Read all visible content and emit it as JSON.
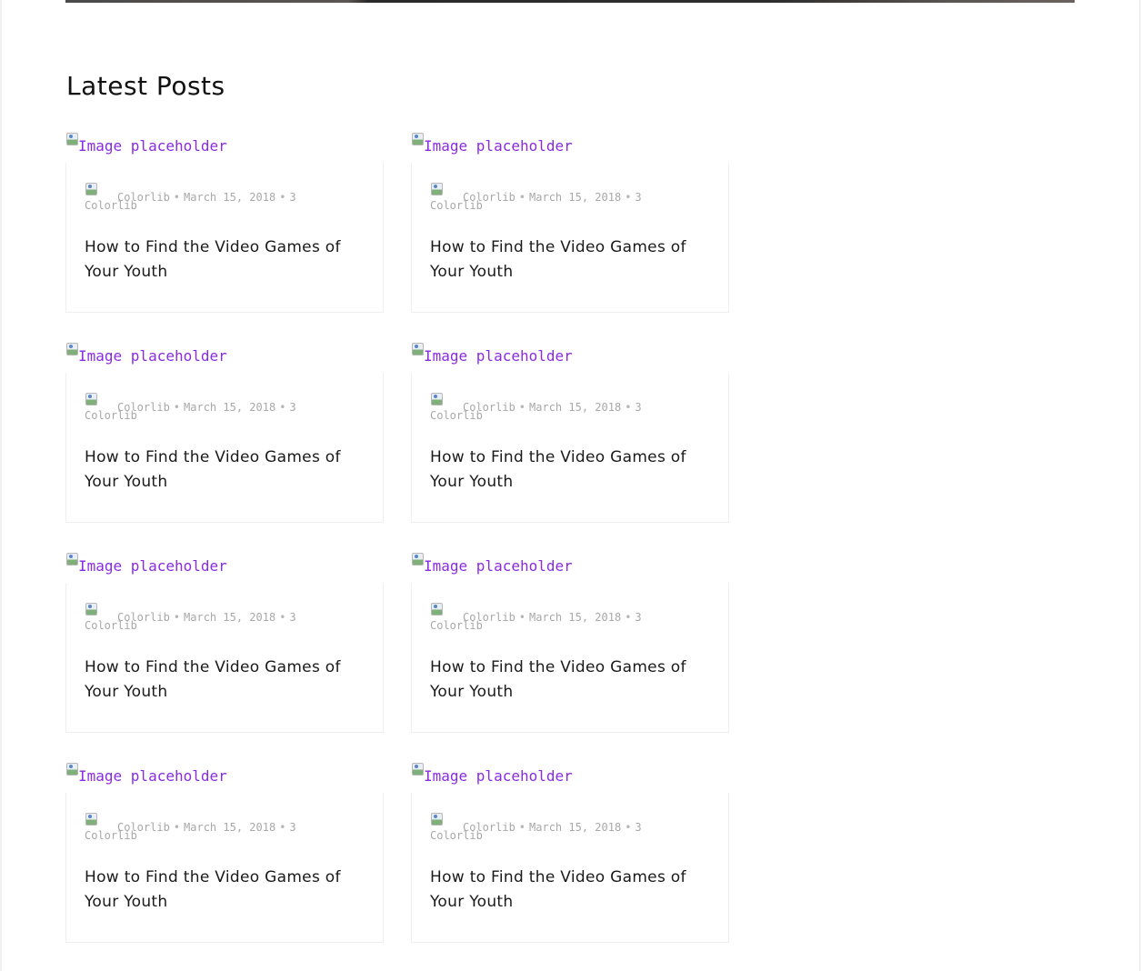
{
  "section": {
    "title": "Latest Posts"
  },
  "posts": [
    {
      "image_alt": "Image placeholder",
      "author_alt": "Colorlib",
      "author": "Colorlib",
      "date": "March 15, 2018",
      "comments": "3",
      "title": "How to Find the Video Games of Your Youth"
    },
    {
      "image_alt": "Image placeholder",
      "author_alt": "Colorlib",
      "author": "Colorlib",
      "date": "March 15, 2018",
      "comments": "3",
      "title": "How to Find the Video Games of Your Youth"
    },
    {
      "image_alt": "Image placeholder",
      "author_alt": "Colorlib",
      "author": "Colorlib",
      "date": "March 15, 2018",
      "comments": "3",
      "title": "How to Find the Video Games of Your Youth"
    },
    {
      "image_alt": "Image placeholder",
      "author_alt": "Colorlib",
      "author": "Colorlib",
      "date": "March 15, 2018",
      "comments": "3",
      "title": "How to Find the Video Games of Your Youth"
    },
    {
      "image_alt": "Image placeholder",
      "author_alt": "Colorlib",
      "author": "Colorlib",
      "date": "March 15, 2018",
      "comments": "3",
      "title": "How to Find the Video Games of Your Youth"
    },
    {
      "image_alt": "Image placeholder",
      "author_alt": "Colorlib",
      "author": "Colorlib",
      "date": "March 15, 2018",
      "comments": "3",
      "title": "How to Find the Video Games of Your Youth"
    },
    {
      "image_alt": "Image placeholder",
      "author_alt": "Colorlib",
      "author": "Colorlib",
      "date": "March 15, 2018",
      "comments": "3",
      "title": "How to Find the Video Games of Your Youth"
    },
    {
      "image_alt": "Image placeholder",
      "author_alt": "Colorlib",
      "author": "Colorlib",
      "date": "March 15, 2018",
      "comments": "3",
      "title": "How to Find the Video Games of Your Youth"
    }
  ],
  "colors": {
    "link": "#8a2be2",
    "meta": "#a8a8a8",
    "title": "#1a1a1a",
    "card_border": "#efefef"
  },
  "icons": {
    "image": "broken-image-icon",
    "avatar": "broken-image-icon"
  }
}
